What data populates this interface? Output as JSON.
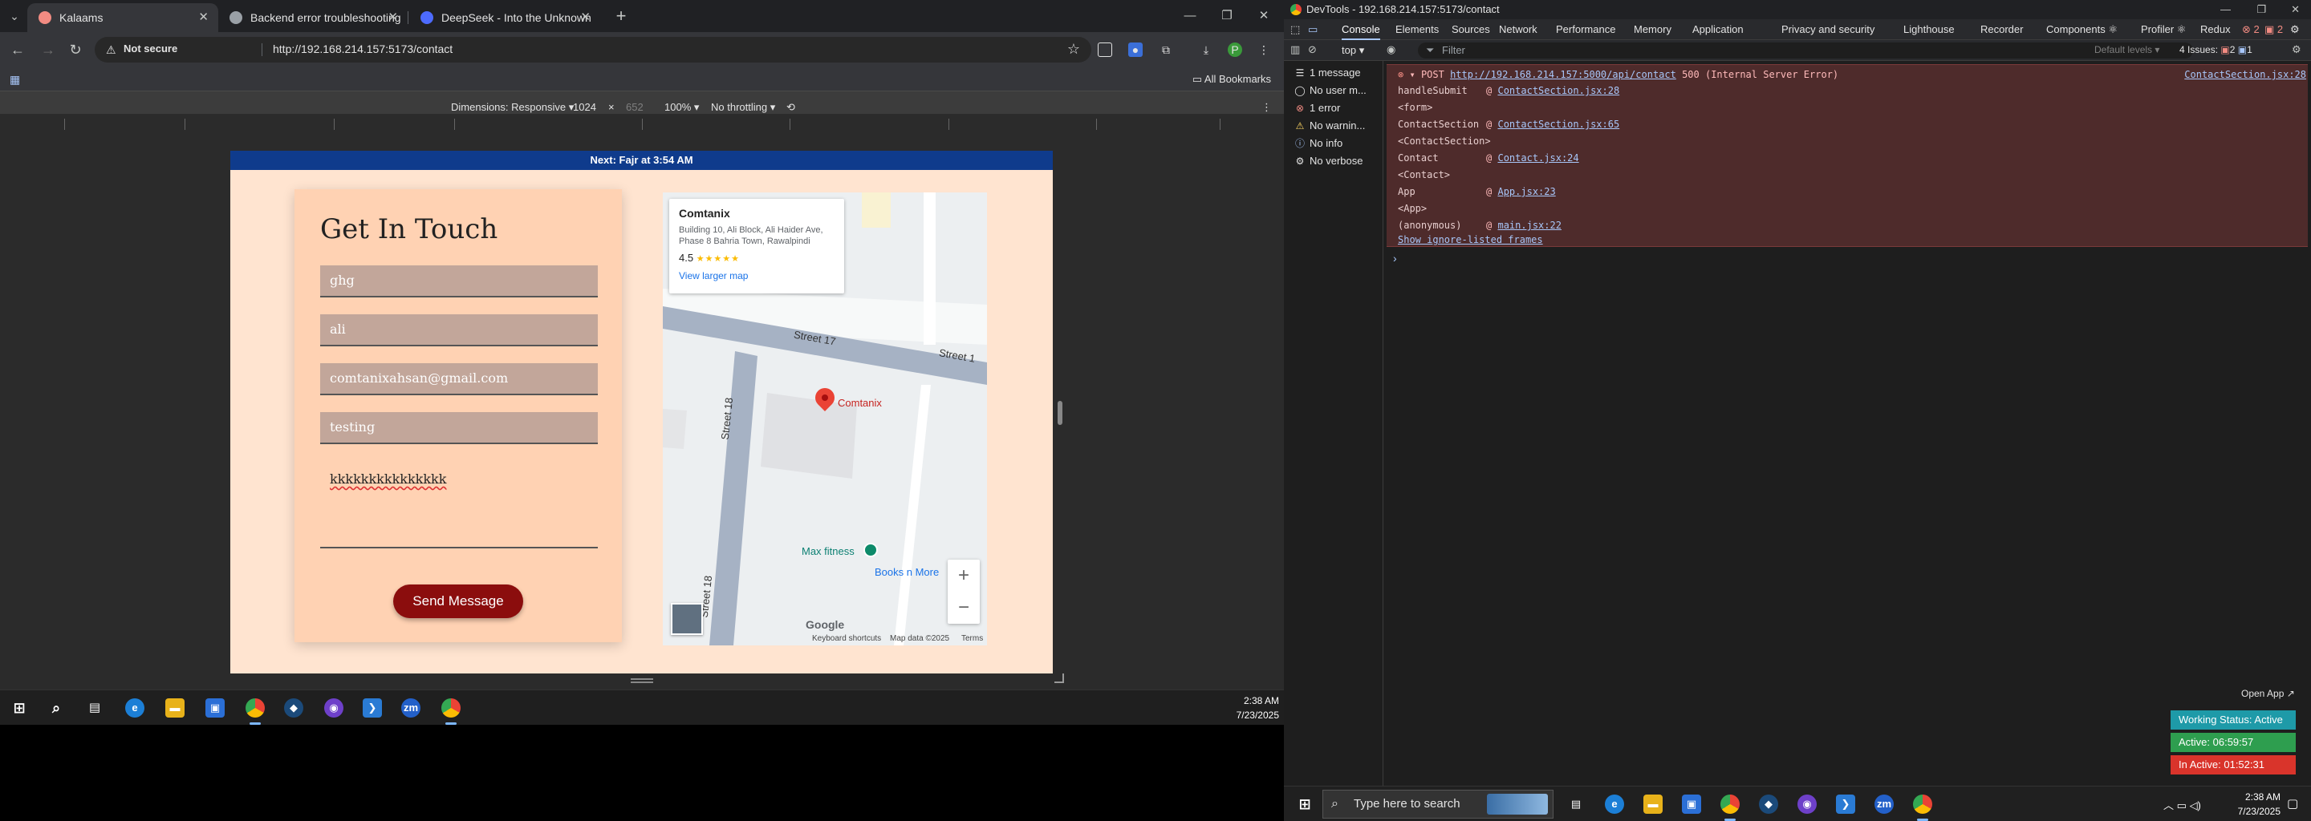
{
  "browser": {
    "tabs": [
      {
        "title": "Kalaams",
        "favicon_color": "#f28b82",
        "active": true
      },
      {
        "title": "Backend error troubleshooting",
        "favicon_color": "#9aa0a6",
        "active": false
      },
      {
        "title": "DeepSeek - Into the Unknown",
        "favicon_color": "#4d6bfe",
        "active": false
      }
    ],
    "not_secure": "Not secure",
    "url": "http://192.168.214.157:5173/contact",
    "all_bookmarks": "All Bookmarks",
    "device_toolbar": {
      "dimensions_label": "Dimensions: Responsive",
      "width": "1024",
      "times": "×",
      "height": "652",
      "zoom": "100%",
      "throttle": "No throttling"
    }
  },
  "page": {
    "prayer_banner": "Next: Fajr at 3:54 AM",
    "contact": {
      "heading": "Get In Touch",
      "fields": [
        "ghg",
        "ali",
        "comtanixahsan@gmail.com",
        "testing"
      ],
      "message": "kkkkkkkkkkkkkkk",
      "send_label": "Send Message"
    },
    "map": {
      "place_name": "Comtanix",
      "address": "Building 10, Ali Block, Ali Haider Ave, Phase 8 Bahria Town, Rawalpindi",
      "rating": "4.5",
      "stars": "★★★★★",
      "view_larger": "View larger map",
      "pin_label": "Comtanix",
      "street_17": "Street 17",
      "street_17b": "Street 1",
      "street_18": "Street 18",
      "street_18b": "Street 18",
      "poi_1": "Max fitness",
      "poi_2": "Books n More",
      "google": "Google",
      "shortcuts": "Keyboard shortcuts",
      "map_data": "Map data ©2025",
      "terms": "Terms"
    }
  },
  "taskbar_left": {
    "time": "2:38 AM",
    "date": "7/23/2025"
  },
  "devtools": {
    "title": "DevTools - 192.168.214.157:5173/contact",
    "tabs": [
      "Console",
      "Elements",
      "Sources",
      "Network",
      "Performance",
      "Memory",
      "Application",
      "Privacy and security",
      "Lighthouse",
      "Recorder",
      "Components ⚛",
      "Profiler ⚛",
      "Redux"
    ],
    "issues_label": "4 Issues:",
    "issue_counts": [
      "2",
      "1"
    ],
    "error_badge": "2",
    "warn_badge": "2",
    "context": "top",
    "filter_placeholder": "Filter",
    "levels": "Default levels",
    "sidebar": [
      {
        "label": "1 message",
        "icon": "list-icon"
      },
      {
        "label": "No user m...",
        "icon": "user-icon"
      },
      {
        "label": "1 error",
        "icon": "error-icon"
      },
      {
        "label": "No warnin...",
        "icon": "warning-icon"
      },
      {
        "label": "No info",
        "icon": "info-icon"
      },
      {
        "label": "No verbose",
        "icon": "verbose-icon"
      }
    ],
    "error": {
      "method": "POST",
      "url": "http://192.168.214.157:5000/api/contact",
      "status": "500 (Internal Server Error)",
      "source": "ContactSection.jsx:28",
      "stack": [
        {
          "k": "handleSubmit",
          "at": "@",
          "link": "ContactSection.jsx:28"
        },
        {
          "k": "<form>",
          "at": "",
          "link": ""
        },
        {
          "k": "ContactSection",
          "at": "@",
          "link": "ContactSection.jsx:65"
        },
        {
          "k": "<ContactSection>",
          "at": "",
          "link": ""
        },
        {
          "k": "Contact",
          "at": "@",
          "link": "Contact.jsx:24"
        },
        {
          "k": "<Contact>",
          "at": "",
          "link": ""
        },
        {
          "k": "App",
          "at": "@",
          "link": "App.jsx:23"
        },
        {
          "k": "<App>",
          "at": "",
          "link": ""
        },
        {
          "k": "(anonymous)",
          "at": "@",
          "link": "main.jsx:22"
        }
      ],
      "ignore_frames": "Show ignore-listed frames"
    },
    "prompt": "›",
    "status_widget": {
      "open_app": "Open App ↗",
      "working": "Working Status: Active",
      "active": "Active: 06:59:57",
      "inactive": "In Active: 01:52:31",
      "colors": {
        "working": "#1e9aa8",
        "active": "#2e9e4f",
        "inactive": "#d9342b"
      }
    }
  },
  "taskbar_right": {
    "search_placeholder": "Type here to search",
    "time": "2:38 AM",
    "date": "7/23/2025"
  }
}
